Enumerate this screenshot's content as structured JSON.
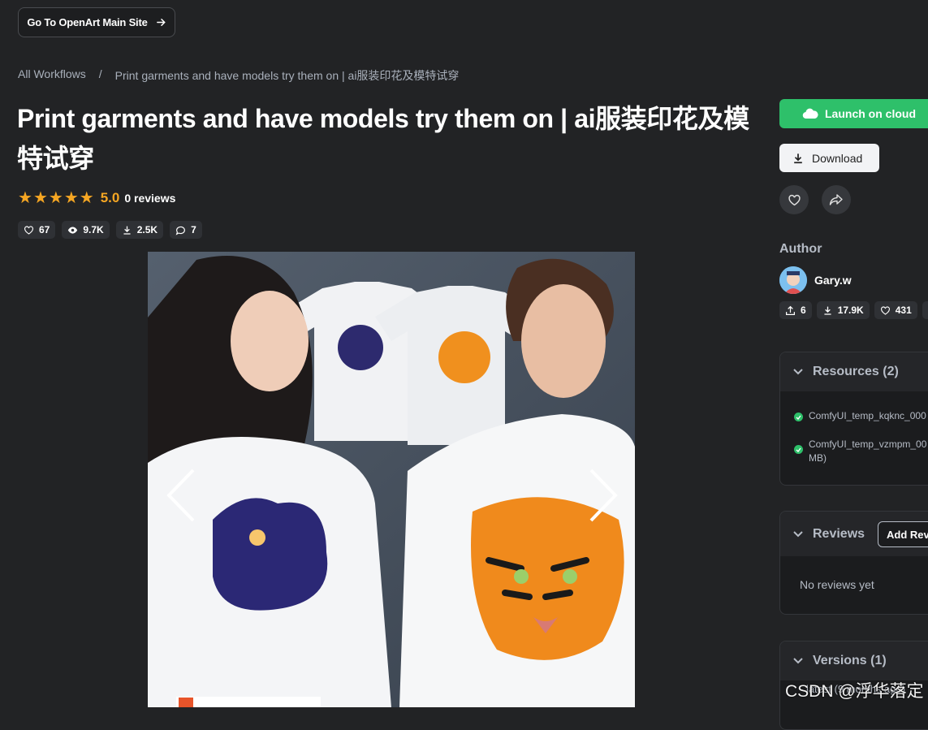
{
  "top_button": {
    "label": "Go To OpenArt Main Site"
  },
  "breadcrumb": {
    "root": "All Workflows",
    "separator": "/",
    "current": "Print garments and have models try them on | ai服装印花及模特试穿"
  },
  "page_title": "Print garments and have models try them on | ai服装印花及模特试穿",
  "rating": {
    "value": "5.0",
    "reviews": "0 reviews",
    "stars": 5
  },
  "stats": {
    "likes": "67",
    "views": "9.7K",
    "downloads": "2.5K",
    "comments": "7"
  },
  "actions": {
    "launch": "Launch on cloud",
    "download": "Download"
  },
  "author": {
    "heading": "Author",
    "name": "Gary.w",
    "uploads": "6",
    "downloads": "17.9K",
    "likes": "431"
  },
  "resources": {
    "heading": "Resources (2)",
    "items": [
      {
        "name": "ComfyUI_temp_kqknc_000"
      },
      {
        "name": "ComfyUI_temp_vzmpm_00",
        "extra": "MB)"
      }
    ]
  },
  "reviews": {
    "heading": "Reviews",
    "add_label": "Add Review",
    "empty": "No reviews yet"
  },
  "versions": {
    "heading": "Versions (1)",
    "latest": "- latest (9 months ago)"
  },
  "watermark": "CSDN @浮华落定",
  "colors": {
    "background": "#222325",
    "accent_green": "#2ec06a",
    "star": "#f5a623"
  }
}
